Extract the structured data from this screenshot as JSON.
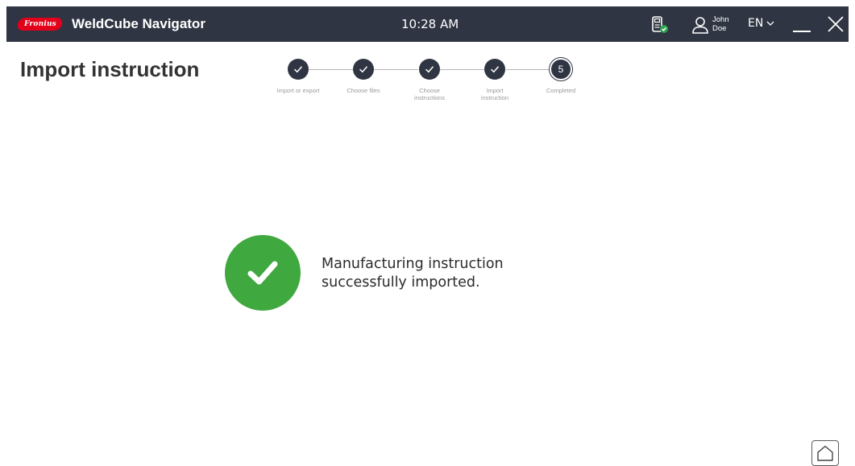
{
  "titlebar": {
    "brand": "Fronius",
    "app_title": "WeldCube Navigator",
    "time": "10:28 AM",
    "user": {
      "first": "John",
      "last": "Doe"
    },
    "language": "EN"
  },
  "page": {
    "title": "Import instruction"
  },
  "stepper": {
    "current_step": 5,
    "steps": [
      {
        "label": "Import or export",
        "status": "done"
      },
      {
        "label": "Choose files",
        "status": "done"
      },
      {
        "label": "Choose\ninstructions",
        "status": "done"
      },
      {
        "label": "Import\ninstruction",
        "status": "done"
      },
      {
        "label": "Completed",
        "status": "current",
        "number": "5"
      }
    ]
  },
  "result": {
    "line1": "Manufacturing instruction",
    "line2": "successfully imported."
  },
  "colors": {
    "titlebar_bg": "#2f3542",
    "brand_red": "#e2001a",
    "success_green": "#3fa83f",
    "status_green": "#2ea44f"
  },
  "icons": [
    "device-status-icon",
    "user-icon",
    "chevron-down-icon",
    "minimize-icon",
    "close-icon",
    "checkmark-icon",
    "home-icon"
  ]
}
